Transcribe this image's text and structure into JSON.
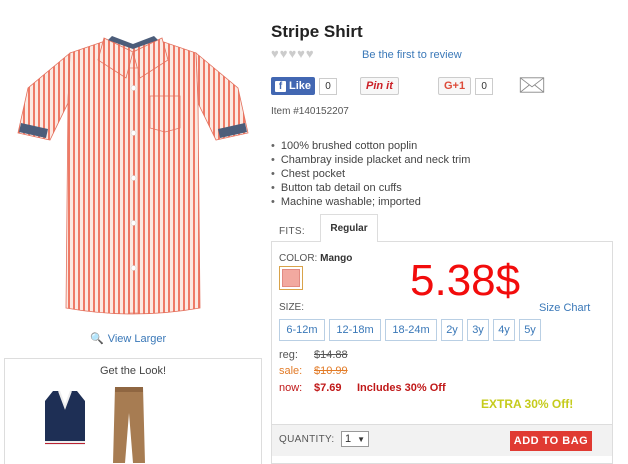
{
  "product": {
    "title": "Stripe Shirt",
    "review_link": "Be the first to review",
    "item_number": "Item #140152207",
    "rating": {
      "filled": 0,
      "total": 5
    }
  },
  "social": {
    "fb_label": "Like",
    "fb_count": "0",
    "pin_label": "Pin it",
    "gplus_label": "G+1",
    "gplus_count": "0"
  },
  "features": [
    "100% brushed cotton poplin",
    "Chambray inside placket and neck trim",
    "Chest pocket",
    "Button tab detail on cuffs",
    "Machine washable; imported"
  ],
  "left": {
    "view_larger": "View Larger",
    "get_the_look": "Get the Look!"
  },
  "options": {
    "fits_label": "FITS:",
    "fit_selected": "Regular",
    "color_label": "COLOR:",
    "color_value": "Mango",
    "swatch_color": "#f2a9a0",
    "size_label": "SIZE:",
    "size_chart": "Size Chart",
    "sizes": [
      "6-12m",
      "12-18m",
      "18-24m",
      "2y",
      "3y",
      "4y",
      "5y"
    ]
  },
  "overlay_price": "5.38$",
  "pricing": {
    "reg_label": "reg:",
    "reg_value": "$14.88",
    "sale_label": "sale:",
    "sale_value": "$10.99",
    "now_label": "now:",
    "now_value": "$7.69",
    "includes": "Includes 30% Off",
    "extra": "EXTRA 30% Off!"
  },
  "cart": {
    "qty_label": "QUANTITY:",
    "qty_value": "1",
    "add_to_bag": "ADD TO BAG"
  },
  "colors": {
    "link": "#3a78b8",
    "sale": "#e27b27",
    "now": "#c01818",
    "overlay_price": "#f20c0c",
    "extra": "#c5cb1c",
    "add_to_bag": "#e03a32"
  }
}
